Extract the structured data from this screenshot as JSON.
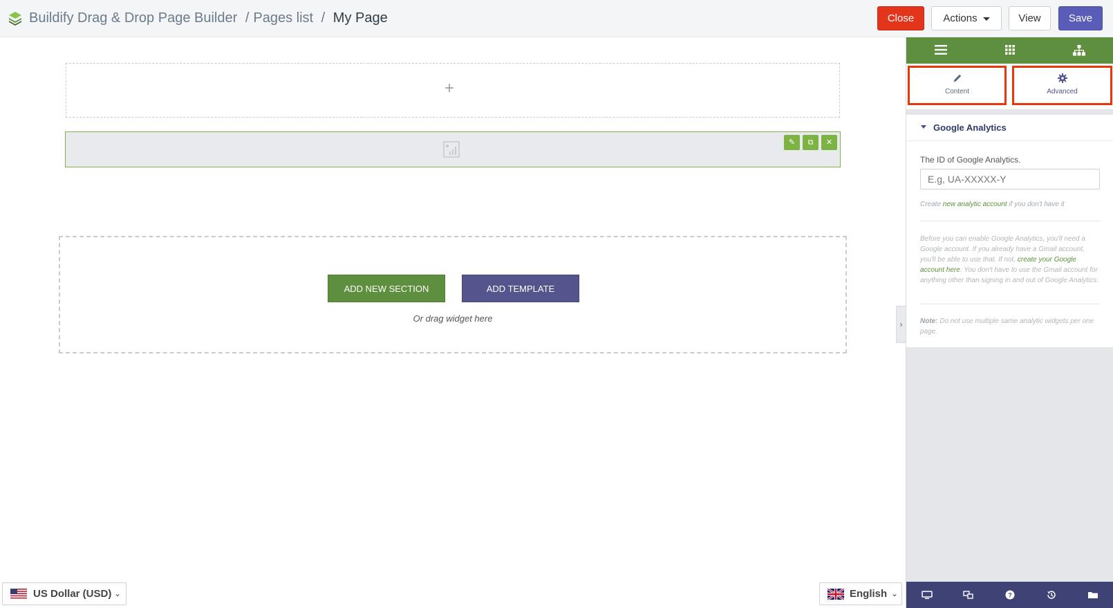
{
  "header": {
    "breadcrumbs": [
      "Buildify Drag & Drop Page Builder",
      "Pages list",
      "My Page"
    ],
    "separator": "/",
    "close_label": "Close",
    "actions_label": "Actions",
    "view_label": "View",
    "save_label": "Save"
  },
  "canvas": {
    "add_section_label": "ADD NEW SECTION",
    "add_template_label": "ADD TEMPLATE",
    "drag_hint": "Or drag widget here"
  },
  "footer": {
    "currency": "US Dollar (USD)",
    "language": "English"
  },
  "panel": {
    "tabs": {
      "content_label": "Content",
      "advanced_label": "Advanced"
    },
    "section_title": "Google Analytics",
    "field_label": "The ID of Google Analytics.",
    "field_placeholder": "E.g, UA-XXXXX-Y",
    "field_value": "",
    "help_prefix": "Create ",
    "help_link": "new analytic account",
    "help_suffix": " if you don't have it",
    "info_part1": "Before you can enable Google Analytics, you'll need a Google account. If you already have a Gmail account, you'll be able to use that. If not, ",
    "info_link": "create your Google account here",
    "info_part2": ". You don't have to use the Gmail account for anything other than signing in and out of Google Analytics.",
    "note_label": "Note:",
    "note_text": " Do not use multiple same analytic widgets per one page."
  },
  "colors": {
    "accent_green": "#5d8f3e",
    "accent_purple": "#54558c",
    "danger_red": "#e3341c",
    "save_blue": "#5a5db8",
    "highlight_red": "#e8360a"
  },
  "icons": {
    "logo": "layers-logo-icon",
    "panel_menu": "hamburger-icon",
    "panel_widgets": "grid-icon",
    "panel_navigator": "sitemap-icon",
    "content_tab": "pencil-icon",
    "advanced_tab": "gear-icon",
    "footer": [
      "desktop-icon",
      "responsive-icon",
      "help-icon",
      "history-icon",
      "folder-icon"
    ]
  }
}
